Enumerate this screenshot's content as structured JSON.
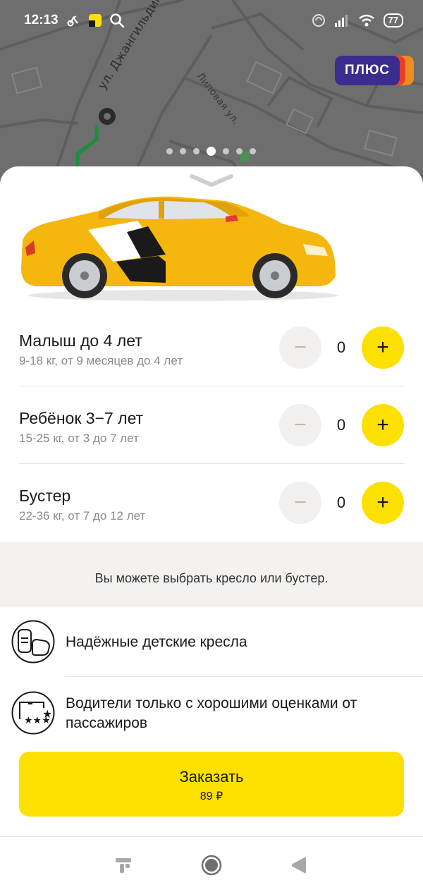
{
  "status_bar": {
    "time": "12:13",
    "battery": "77",
    "icons_left": [
      "bike-icon",
      "yandex-go-icon",
      "search-icon"
    ],
    "icons_right": [
      "nfc-icon",
      "signal-icon",
      "wifi-icon",
      "battery-icon"
    ]
  },
  "map": {
    "streets": [
      "ул. Джангильдина",
      "Липовая ул."
    ],
    "plus_badge": "ПЛЮС",
    "pager": {
      "count": 7,
      "active_index": 3
    }
  },
  "seats": [
    {
      "title": "Малыш до 4 лет",
      "subtitle": "9-18 кг, от 9 месяцев до 4 лет",
      "count": "0",
      "minus": "−",
      "plus": "+"
    },
    {
      "title": "Ребёнок 3−7 лет",
      "subtitle": "15-25 кг, от 3 до 7 лет",
      "count": "0",
      "minus": "−",
      "plus": "+"
    },
    {
      "title": "Бустер",
      "subtitle": "22-36 кг, от 7 до 12 лет",
      "count": "0",
      "minus": "−",
      "plus": "+"
    }
  ],
  "note": "Вы можете выбрать кресло или бустер.",
  "features": [
    {
      "icon": "child-seats-icon",
      "text": "Надёжные детские кресла"
    },
    {
      "icon": "rated-driver-icon",
      "text": "Водители только с хорошими оценками от пассажиров"
    }
  ],
  "order": {
    "label": "Заказать",
    "price": "89 ₽"
  },
  "colors": {
    "accent": "#fce000",
    "plus_badge": "#3b2d8f",
    "route": "#1a8f3c"
  }
}
